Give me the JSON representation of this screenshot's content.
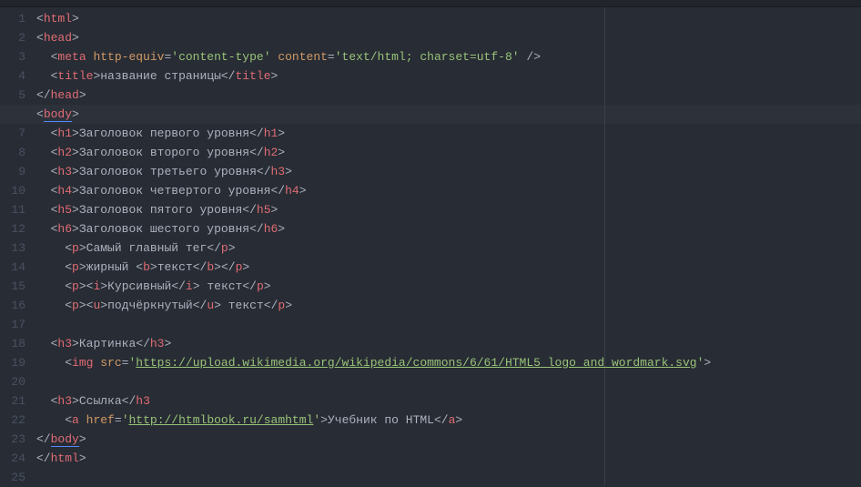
{
  "editor": {
    "active_line": 6,
    "ruler_col": 80,
    "tokens": [
      [
        [
          "br",
          "<"
        ],
        [
          "tg",
          "html"
        ],
        [
          "br",
          ">"
        ]
      ],
      [
        [
          "br",
          "<"
        ],
        [
          "tg",
          "head"
        ],
        [
          "br",
          ">"
        ]
      ],
      [
        [
          "tx",
          "  "
        ],
        [
          "br",
          "<"
        ],
        [
          "tg",
          "meta"
        ],
        [
          "tx",
          " "
        ],
        [
          "at",
          "http-equiv"
        ],
        [
          "eq",
          "="
        ],
        [
          "sv",
          "'content-type'"
        ],
        [
          "tx",
          " "
        ],
        [
          "at",
          "content"
        ],
        [
          "eq",
          "="
        ],
        [
          "sv",
          "'text/html; charset=utf-8'"
        ],
        [
          "tx",
          " "
        ],
        [
          "br",
          "/>"
        ]
      ],
      [
        [
          "tx",
          "  "
        ],
        [
          "br",
          "<"
        ],
        [
          "tg",
          "title"
        ],
        [
          "br",
          ">"
        ],
        [
          "tx",
          "название страницы"
        ],
        [
          "br",
          "</"
        ],
        [
          "tg",
          "title"
        ],
        [
          "br",
          ">"
        ]
      ],
      [
        [
          "br",
          "</"
        ],
        [
          "tg",
          "head"
        ],
        [
          "br",
          ">"
        ]
      ],
      [
        [
          "br",
          "<"
        ],
        [
          "tg",
          "body",
          "cursor"
        ],
        [
          "br",
          ">"
        ]
      ],
      [
        [
          "tx",
          "  "
        ],
        [
          "br",
          "<"
        ],
        [
          "tg",
          "h1"
        ],
        [
          "br",
          ">"
        ],
        [
          "tx",
          "Заголовок первого уровня"
        ],
        [
          "br",
          "</"
        ],
        [
          "tg",
          "h1"
        ],
        [
          "br",
          ">"
        ]
      ],
      [
        [
          "tx",
          "  "
        ],
        [
          "br",
          "<"
        ],
        [
          "tg",
          "h2"
        ],
        [
          "br",
          ">"
        ],
        [
          "tx",
          "Заголовок второго уровня"
        ],
        [
          "br",
          "</"
        ],
        [
          "tg",
          "h2"
        ],
        [
          "br",
          ">"
        ]
      ],
      [
        [
          "tx",
          "  "
        ],
        [
          "br",
          "<"
        ],
        [
          "tg",
          "h3"
        ],
        [
          "br",
          ">"
        ],
        [
          "tx",
          "Заголовок третьего уровня"
        ],
        [
          "br",
          "</"
        ],
        [
          "tg",
          "h3"
        ],
        [
          "br",
          ">"
        ]
      ],
      [
        [
          "tx",
          "  "
        ],
        [
          "br",
          "<"
        ],
        [
          "tg",
          "h4"
        ],
        [
          "br",
          ">"
        ],
        [
          "tx",
          "Заголовок четвертого уровня"
        ],
        [
          "br",
          "</"
        ],
        [
          "tg",
          "h4"
        ],
        [
          "br",
          ">"
        ]
      ],
      [
        [
          "tx",
          "  "
        ],
        [
          "br",
          "<"
        ],
        [
          "tg",
          "h5"
        ],
        [
          "br",
          ">"
        ],
        [
          "tx",
          "Заголовок пятого уровня"
        ],
        [
          "br",
          "</"
        ],
        [
          "tg",
          "h5"
        ],
        [
          "br",
          ">"
        ]
      ],
      [
        [
          "tx",
          "  "
        ],
        [
          "br",
          "<"
        ],
        [
          "tg",
          "h6"
        ],
        [
          "br",
          ">"
        ],
        [
          "tx",
          "Заголовок шестого уровня"
        ],
        [
          "br",
          "</"
        ],
        [
          "tg",
          "h6"
        ],
        [
          "br",
          ">"
        ]
      ],
      [
        [
          "tx",
          "    "
        ],
        [
          "br",
          "<"
        ],
        [
          "tg",
          "p"
        ],
        [
          "br",
          ">"
        ],
        [
          "tx",
          "Самый главный тег"
        ],
        [
          "br",
          "</"
        ],
        [
          "tg",
          "p"
        ],
        [
          "br",
          ">"
        ]
      ],
      [
        [
          "tx",
          "    "
        ],
        [
          "br",
          "<"
        ],
        [
          "tg",
          "p"
        ],
        [
          "br",
          ">"
        ],
        [
          "tx",
          "жирный "
        ],
        [
          "br",
          "<"
        ],
        [
          "tg",
          "b"
        ],
        [
          "br",
          ">"
        ],
        [
          "tx",
          "текст"
        ],
        [
          "br",
          "</"
        ],
        [
          "tg",
          "b"
        ],
        [
          "br",
          ">"
        ],
        [
          "br",
          "</"
        ],
        [
          "tg",
          "p"
        ],
        [
          "br",
          ">"
        ]
      ],
      [
        [
          "tx",
          "    "
        ],
        [
          "br",
          "<"
        ],
        [
          "tg",
          "p"
        ],
        [
          "br",
          ">"
        ],
        [
          "br",
          "<"
        ],
        [
          "tg",
          "i"
        ],
        [
          "br",
          ">"
        ],
        [
          "tx",
          "Курсивный"
        ],
        [
          "br",
          "</"
        ],
        [
          "tg",
          "i"
        ],
        [
          "br",
          ">"
        ],
        [
          "tx",
          " текст"
        ],
        [
          "br",
          "</"
        ],
        [
          "tg",
          "p"
        ],
        [
          "br",
          ">"
        ]
      ],
      [
        [
          "tx",
          "    "
        ],
        [
          "br",
          "<"
        ],
        [
          "tg",
          "p"
        ],
        [
          "br",
          ">"
        ],
        [
          "br",
          "<"
        ],
        [
          "tg",
          "u"
        ],
        [
          "br",
          ">"
        ],
        [
          "tx",
          "подчёркнутый"
        ],
        [
          "br",
          "</"
        ],
        [
          "tg",
          "u"
        ],
        [
          "br",
          ">"
        ],
        [
          "tx",
          " текст"
        ],
        [
          "br",
          "</"
        ],
        [
          "tg",
          "p"
        ],
        [
          "br",
          ">"
        ]
      ],
      [],
      [
        [
          "tx",
          "  "
        ],
        [
          "br",
          "<"
        ],
        [
          "tg",
          "h3"
        ],
        [
          "br",
          ">"
        ],
        [
          "tx",
          "Картинка"
        ],
        [
          "br",
          "</"
        ],
        [
          "tg",
          "h3"
        ],
        [
          "br",
          ">"
        ]
      ],
      [
        [
          "tx",
          "    "
        ],
        [
          "br",
          "<"
        ],
        [
          "tg",
          "img"
        ],
        [
          "tx",
          " "
        ],
        [
          "at",
          "src"
        ],
        [
          "eq",
          "="
        ],
        [
          "sv",
          "'"
        ],
        [
          "lk",
          "https://upload.wikimedia.org/wikipedia/commons/6/61/HTML5_logo_and_wordmark.svg"
        ],
        [
          "sv",
          "'"
        ],
        [
          "br",
          ">"
        ]
      ],
      [],
      [
        [
          "tx",
          "  "
        ],
        [
          "br",
          "<"
        ],
        [
          "tg",
          "h3"
        ],
        [
          "br",
          ">"
        ],
        [
          "tx",
          "Ссылка"
        ],
        [
          "br",
          "</"
        ],
        [
          "tg",
          "h3"
        ]
      ],
      [
        [
          "tx",
          "    "
        ],
        [
          "br",
          "<"
        ],
        [
          "tg",
          "a"
        ],
        [
          "tx",
          " "
        ],
        [
          "at",
          "href"
        ],
        [
          "eq",
          "="
        ],
        [
          "sv",
          "'"
        ],
        [
          "lk",
          "http://htmlbook.ru/samhtml"
        ],
        [
          "sv",
          "'"
        ],
        [
          "br",
          ">"
        ],
        [
          "tx",
          "Учебник по HTML"
        ],
        [
          "br",
          "</"
        ],
        [
          "tg",
          "a"
        ],
        [
          "br",
          ">"
        ]
      ],
      [
        [
          "br",
          "</"
        ],
        [
          "tg",
          "body",
          "cursor"
        ],
        [
          "br",
          ">"
        ]
      ],
      [
        [
          "br",
          "</"
        ],
        [
          "tg",
          "html"
        ],
        [
          "br",
          ">"
        ]
      ],
      []
    ]
  }
}
